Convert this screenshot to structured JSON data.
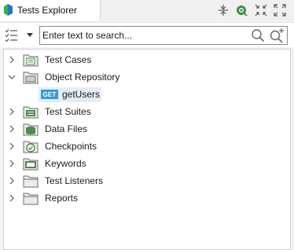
{
  "tab": {
    "title": "Tests Explorer",
    "icon": "katalon-logo-icon"
  },
  "toolbar": {
    "buttons": [
      "collapse-all-icon",
      "link-with-editor-icon",
      "minimize-icon",
      "maximize-icon"
    ]
  },
  "search": {
    "placeholder": "Enter text to search...",
    "value": "",
    "filter_icon": "filter-list-icon",
    "search_icon": "magnifier-icon",
    "advanced_icon": "advanced-search-icon"
  },
  "tree": {
    "items": [
      {
        "label": "Test Cases",
        "expanded": false,
        "icon": "test-cases-folder-icon"
      },
      {
        "label": "Object Repository",
        "expanded": true,
        "icon": "object-repository-folder-icon",
        "children": [
          {
            "badge": "GET",
            "label": "getUsers"
          }
        ]
      },
      {
        "label": "Test Suites",
        "expanded": false,
        "icon": "test-suites-folder-icon"
      },
      {
        "label": "Data Files",
        "expanded": false,
        "icon": "data-files-folder-icon"
      },
      {
        "label": "Checkpoints",
        "expanded": false,
        "icon": "checkpoints-folder-icon"
      },
      {
        "label": "Keywords",
        "expanded": false,
        "icon": "keywords-folder-icon"
      },
      {
        "label": "Test Listeners",
        "expanded": false,
        "icon": "test-listeners-folder-icon"
      },
      {
        "label": "Reports",
        "expanded": false,
        "icon": "reports-folder-icon"
      }
    ]
  },
  "colors": {
    "badge": "#2f9fd9",
    "selection": "#e4ecf6",
    "folder": "#4f8a4f"
  }
}
